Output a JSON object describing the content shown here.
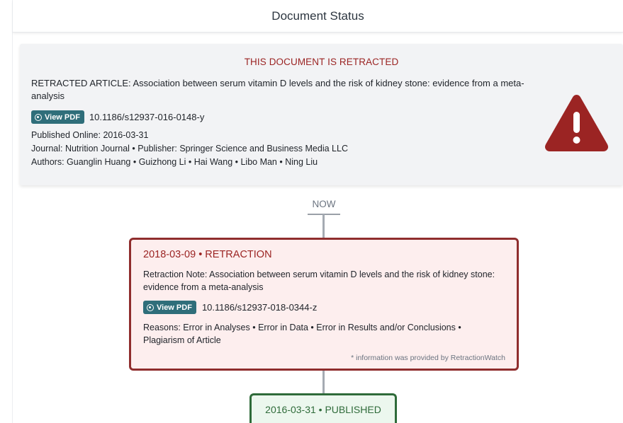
{
  "header": {
    "title": "Document Status"
  },
  "document": {
    "banner": "THIS DOCUMENT IS RETRACTED",
    "title": "RETRACTED ARTICLE: Association between serum vitamin D levels and the risk of kidney stone: evidence from a meta-analysis",
    "view_pdf_label": "View PDF",
    "doi": "10.1186/s12937-016-0148-y",
    "published_online": "Published Online: 2016-03-31",
    "journal_publisher": "Journal: Nutrition Journal • Publisher: Springer Science and Business Media LLC",
    "authors": "Authors: Guanglin Huang • Guizhong Li • Hai Wang • Libo Man • Ning Liu",
    "warning_icon": "warning-triangle-icon"
  },
  "timeline": {
    "now_label": "NOW",
    "retraction": {
      "heading": "2018-03-09 • RETRACTION",
      "note": "Retraction Note: Association between serum vitamin D levels and the risk of kidney stone: evidence from a meta-analysis",
      "view_pdf_label": "View PDF",
      "doi": "10.1186/s12937-018-0344-z",
      "reasons": "Reasons:  Error in Analyses  •  Error in Data  •  Error in Results and/or Conclusions  •  Plagiarism of Article",
      "footnote": "* information was provided by RetractionWatch"
    },
    "published": {
      "heading": "2016-03-31 • PUBLISHED"
    }
  },
  "colors": {
    "retracted_red": "#9b2423",
    "card_border_red": "#8f2d2d",
    "published_green": "#2f6b3a",
    "pdf_button": "#2f6e7a"
  }
}
